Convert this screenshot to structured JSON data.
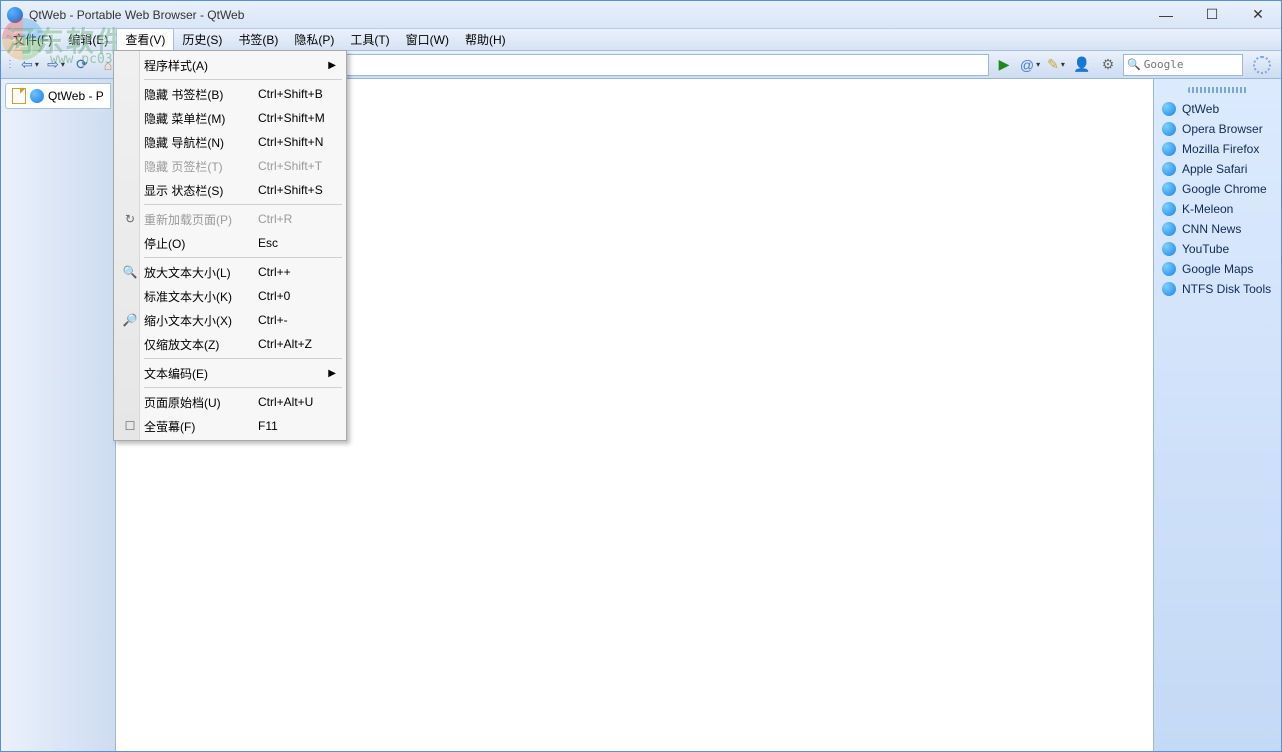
{
  "window": {
    "title": "QtWeb - Portable Web Browser - QtWeb"
  },
  "menubar": [
    "文件(F)",
    "编辑(E)",
    "查看(V)",
    "历史(S)",
    "书签(B)",
    "隐私(P)",
    "工具(T)",
    "窗口(W)",
    "帮助(H)"
  ],
  "active_menu_index": 2,
  "dropdown": [
    {
      "label": "程序样式(A)",
      "accel": "",
      "submenu": true
    },
    {
      "sep": true
    },
    {
      "label": "隐藏 书签栏(B)",
      "accel": "Ctrl+Shift+B"
    },
    {
      "label": "隐藏 菜单栏(M)",
      "accel": "Ctrl+Shift+M"
    },
    {
      "label": "隐藏 导航栏(N)",
      "accel": "Ctrl+Shift+N"
    },
    {
      "label": "隐藏 页签栏(T)",
      "accel": "Ctrl+Shift+T",
      "disabled": true
    },
    {
      "label": "显示 状态栏(S)",
      "accel": "Ctrl+Shift+S"
    },
    {
      "sep": true
    },
    {
      "label": "重新加载页面(P)",
      "accel": "Ctrl+R",
      "disabled": true,
      "icon": "↻"
    },
    {
      "label": "停止(O)",
      "accel": "Esc"
    },
    {
      "sep": true
    },
    {
      "label": "放大文本大小(L)",
      "accel": "Ctrl++",
      "icon": "🔍"
    },
    {
      "label": "标准文本大小(K)",
      "accel": "Ctrl+0"
    },
    {
      "label": "缩小文本大小(X)",
      "accel": "Ctrl+-",
      "icon": "🔎"
    },
    {
      "label": "仅缩放文本(Z)",
      "accel": "Ctrl+Alt+Z"
    },
    {
      "sep": true
    },
    {
      "label": "文本编码(E)",
      "accel": "",
      "submenu": true
    },
    {
      "sep": true
    },
    {
      "label": "页面原始档(U)",
      "accel": "Ctrl+Alt+U"
    },
    {
      "label": "全萤幕(F)",
      "accel": "F11",
      "icon": "☐"
    }
  ],
  "tab": {
    "label": "QtWeb - P"
  },
  "search": {
    "placeholder": "Google",
    "prefix": "🔍"
  },
  "bookmarks": [
    "QtWeb",
    "Opera Browser",
    "Mozilla Firefox",
    "Apple Safari",
    "Google Chrome",
    "K-Meleon",
    "CNN News",
    "YouTube",
    "Google Maps",
    "NTFS Disk Tools"
  ],
  "watermark": {
    "text": "河东软件园",
    "url": "www.pc0359.cn"
  }
}
